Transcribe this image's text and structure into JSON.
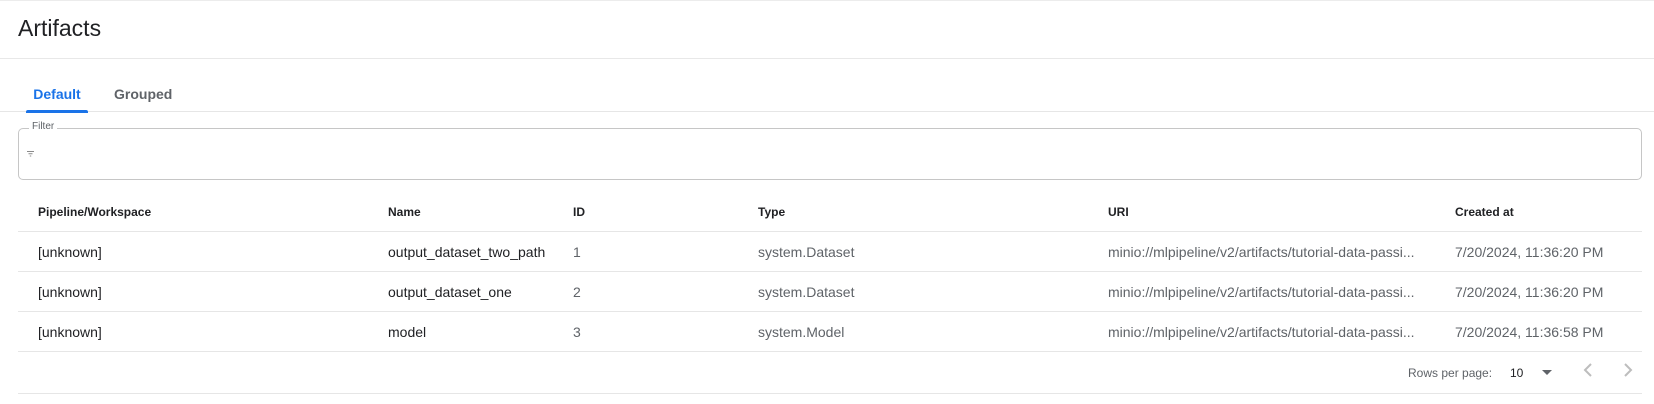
{
  "header": {
    "title": "Artifacts"
  },
  "tabs": [
    {
      "label": "Default",
      "active": true
    },
    {
      "label": "Grouped",
      "active": false
    }
  ],
  "filter": {
    "label": "Filter",
    "value": "",
    "icon": "filter-icon"
  },
  "table": {
    "columns": [
      "Pipeline/Workspace",
      "Name",
      "ID",
      "Type",
      "URI",
      "Created at"
    ],
    "rows": [
      [
        "[unknown]",
        "output_dataset_two_path",
        "1",
        "system.Dataset",
        "minio://mlpipeline/v2/artifacts/tutorial-data-passi...",
        "7/20/2024, 11:36:20 PM"
      ],
      [
        "[unknown]",
        "output_dataset_one",
        "2",
        "system.Dataset",
        "minio://mlpipeline/v2/artifacts/tutorial-data-passi...",
        "7/20/2024, 11:36:20 PM"
      ],
      [
        "[unknown]",
        "model",
        "3",
        "system.Model",
        "minio://mlpipeline/v2/artifacts/tutorial-data-passi...",
        "7/20/2024, 11:36:58 PM"
      ]
    ]
  },
  "pagination": {
    "rows_per_page_label": "Rows per page:",
    "rows_per_page_value": "10",
    "prev_icon": "chevron-left-icon",
    "next_icon": "chevron-right-icon"
  },
  "colors": {
    "accent": "#1a73e8",
    "text_primary": "#202124",
    "text_secondary": "#5f6368",
    "divider": "#e6e6e6"
  }
}
